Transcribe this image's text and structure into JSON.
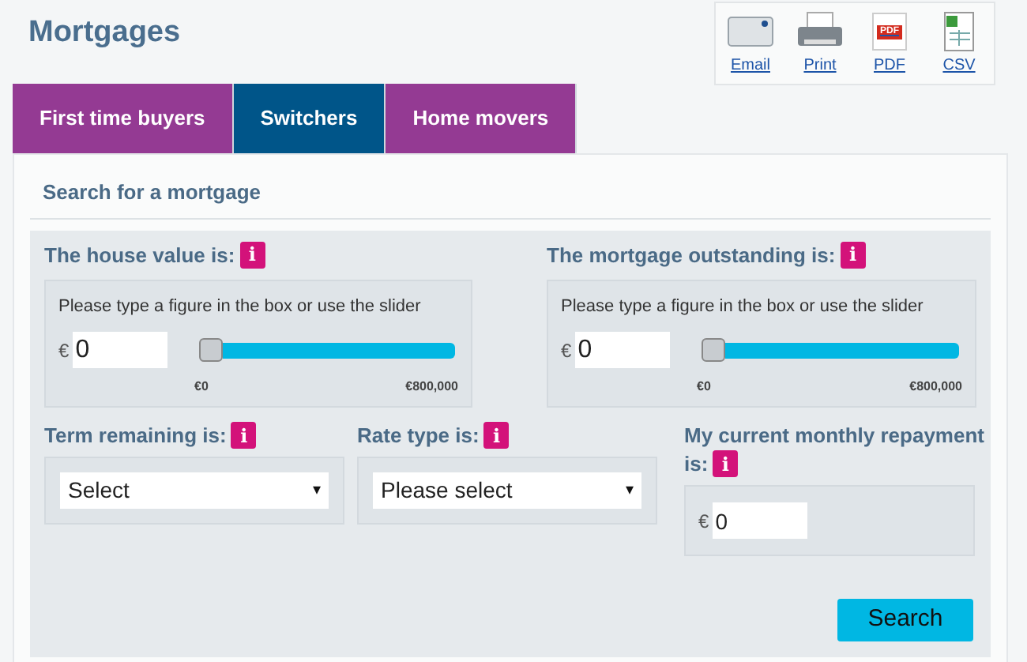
{
  "title": "Mortgages",
  "exports": [
    {
      "kind": "email",
      "label": "Email"
    },
    {
      "kind": "print",
      "label": "Print"
    },
    {
      "kind": "pdf",
      "label": "PDF",
      "badge": "PDF"
    },
    {
      "kind": "csv",
      "label": "CSV"
    }
  ],
  "tabs": [
    {
      "label": "First time buyers",
      "selected": false
    },
    {
      "label": "Switchers",
      "selected": true
    },
    {
      "label": "Home movers",
      "selected": false
    }
  ],
  "section_title": "Search for a mortgage",
  "sliders": [
    {
      "label": "The house value is:",
      "info": "i",
      "hint": "Please type a figure in the box or use the slider",
      "currency": "€",
      "value": "0",
      "level": 0,
      "min": "€0",
      "max": "€800,000"
    },
    {
      "label": "The mortgage outstanding is:",
      "info": "i",
      "hint": "Please type a figure in the box or use the slider",
      "currency": "€",
      "value": "0",
      "level": 0,
      "min": "€0",
      "max": "€800,000"
    }
  ],
  "selects": [
    {
      "label": "Term remaining is:",
      "info": "i",
      "value": "Select",
      "caret": "▾"
    },
    {
      "label": "Rate type is:",
      "info": "i",
      "value": "Please select",
      "caret": "▾"
    }
  ],
  "repayment": {
    "label_lines": [
      "My current monthly repayment",
      "is:"
    ],
    "info": "i",
    "currency": "€",
    "value": "0"
  },
  "search_button": "Search"
}
